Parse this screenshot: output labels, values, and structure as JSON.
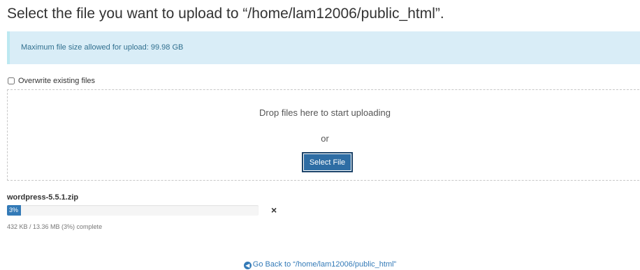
{
  "page": {
    "title": "Select the file you want to upload to “/home/lam12006/public_html”."
  },
  "info": {
    "max_size_text": "Maximum file size allowed for upload: 99.98 GB"
  },
  "overwrite": {
    "label": "Overwrite existing files",
    "checked": false
  },
  "dropzone": {
    "drop_text": "Drop files here to start uploading",
    "or_text": "or",
    "select_button_label": "Select File"
  },
  "upload": {
    "file_name": "wordpress-5.5.1.zip",
    "progress_percent": 3,
    "progress_label": "3%",
    "status_text": "432 KB / 13.36 MB (3%) complete",
    "remove_icon": "close-icon",
    "remove_glyph": "×"
  },
  "footer": {
    "go_back_label": "Go Back to “/home/lam12006/public_html”",
    "go_back_icon": "arrow-left-circle-icon",
    "go_back_glyph": "◀"
  },
  "colors": {
    "info_background": "#d9edf7",
    "accent": "#337ab7",
    "button": "#2e6da4"
  }
}
